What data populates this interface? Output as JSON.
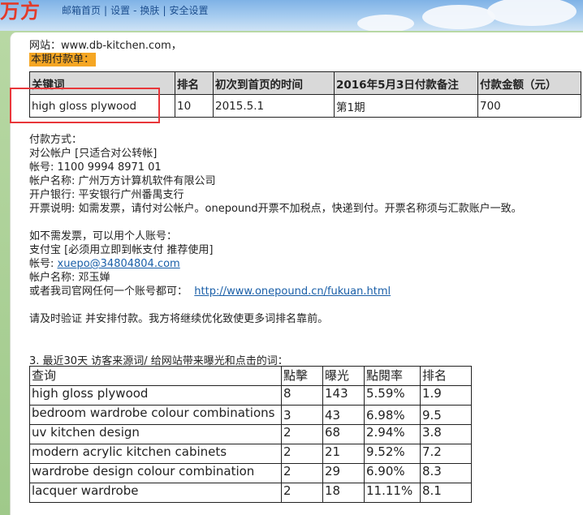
{
  "header": {
    "logo_text": "万方",
    "nav": [
      "邮箱首页",
      "设置",
      "换肤",
      "安全设置"
    ]
  },
  "site_line": "网站：www.db-kitchen.com，",
  "period_label": "本期付款单：",
  "payment_table": {
    "headers": [
      "关键词",
      "排名",
      "初次到首页的时间",
      "2016年5月3日付款备注",
      "付款金额（元）"
    ],
    "rows": [
      [
        "high gloss plywood",
        "10",
        "2015.5.1",
        "第1期",
        "700"
      ]
    ]
  },
  "payment": {
    "lines": [
      "付款方式：",
      "对公帐户 [只适合对公转帐]",
      "帐号: 1100 9994 8971 01",
      "帐户名称: 广州万方计算机软件有限公司",
      "开户银行: 平安银行广州番禺支行",
      "开票说明: 如需发票，请付对公帐户。onepound开票不加税点，快递到付。开票名称须与汇款账户一致。",
      "",
      "如不需发票，可以用个人账号：",
      "支付宝 [必须用立即到帐支付 推荐使用]"
    ],
    "account_label": "帐号: ",
    "account_email": "xuepo@34804804.com",
    "account_name": "帐户名称: 邓玉婵",
    "other_label": "或者我司官网任何一个账号都可：",
    "other_link": "http://www.onepound.cn/fukuan.html",
    "notice": "请及时验证 并安排付款。我方将继续优化致使更多词排名靠前。"
  },
  "section3": {
    "title": "3.   最近30天 访客来源词/ 给网站带来曝光和点击的词：",
    "headers": [
      "查询",
      "點擊",
      "曝光",
      "點閱率",
      "排名"
    ],
    "rows": [
      [
        "high gloss plywood",
        "8",
        "143",
        "5.59%",
        "1.9"
      ],
      [
        "bedroom wardrobe colour combinations",
        "3",
        "43",
        "6.98%",
        "9.5"
      ],
      [
        "uv kitchen design",
        "2",
        "68",
        "2.94%",
        "3.8"
      ],
      [
        "modern acrylic kitchen cabinets",
        "2",
        "21",
        "9.52%",
        "7.2"
      ],
      [
        "wardrobe design colour combination",
        "2",
        "29",
        "6.90%",
        "8.3"
      ],
      [
        "lacquer wardrobe",
        "2",
        "18",
        "11.11%",
        "8.1"
      ]
    ]
  },
  "colors": {
    "highlight_box": "#e8363a",
    "period_badge": "#f5a623",
    "link": "#1a5fa8",
    "logo": "#e23b2a"
  }
}
